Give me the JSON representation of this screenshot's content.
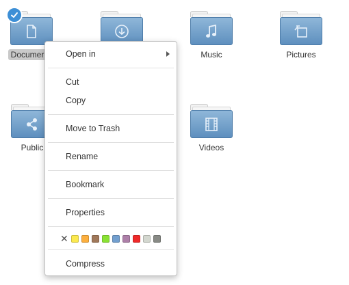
{
  "folders": {
    "documents": {
      "label": "Documer",
      "selected": true,
      "icon": "document-icon"
    },
    "downloads": {
      "label": "",
      "icon": "download-icon"
    },
    "music": {
      "label": "Music",
      "icon": "music-note-icon"
    },
    "pictures": {
      "label": "Pictures",
      "icon": "picture-icon"
    },
    "public": {
      "label": "Public",
      "icon": "share-icon"
    },
    "videos": {
      "label": "Videos",
      "icon": "film-icon"
    }
  },
  "context_menu": {
    "open_in": "Open in",
    "cut": "Cut",
    "copy": "Copy",
    "move_to_trash": "Move to Trash",
    "rename": "Rename",
    "bookmark": "Bookmark",
    "properties": "Properties",
    "compress": "Compress",
    "clear_color_glyph": "✕",
    "color_tags": [
      "#fce94f",
      "#fcaf3e",
      "#a0785a",
      "#8ae234",
      "#729fcf",
      "#ad7fa8",
      "#ef2929",
      "#d3d7cf",
      "#888a85"
    ]
  },
  "colors": {
    "folder_top": "#8fb7d9",
    "folder_bottom": "#5e8fbe",
    "selection_check": "#3d8fd6"
  }
}
